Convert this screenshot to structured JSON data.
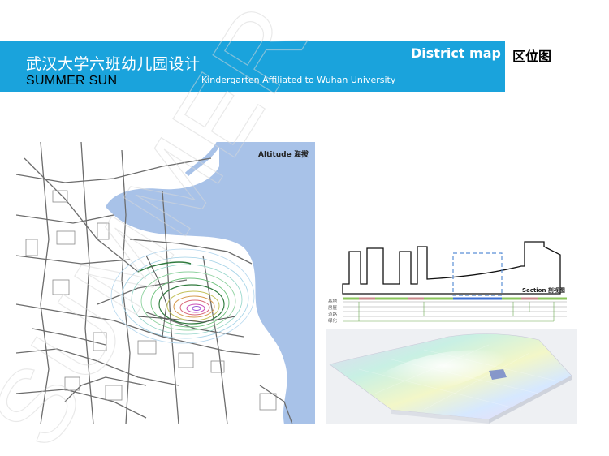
{
  "header": {
    "title_cn": "武汉大学六班幼儿园设计",
    "title_en": "SUMMER SUN",
    "subtitle": "Kindergarten Affiliated to Wuhan University",
    "district_en": "District map",
    "district_cn": "区位图",
    "banner_color": "#1aa3dc"
  },
  "watermark": {
    "text": "SUMMER SUN"
  },
  "map": {
    "label": "Altitude 海拔",
    "water_color": "#a8c2e8"
  },
  "section": {
    "label": "Section 剖视图",
    "legend": [
      "基地",
      "房屋",
      "道路",
      "绿化"
    ]
  }
}
